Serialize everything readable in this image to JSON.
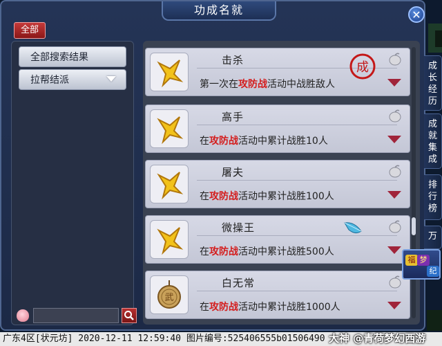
{
  "window": {
    "title": "功成名就",
    "close_label": "✕"
  },
  "filter": {
    "all_label": "全部"
  },
  "left_menu": {
    "items": [
      {
        "label": "全部搜索结果"
      },
      {
        "label": "拉帮结派"
      }
    ]
  },
  "search": {
    "placeholder": ""
  },
  "achievements": [
    {
      "title": "击杀",
      "desc_prefix": "第一次在",
      "highlight": "攻防战",
      "desc_suffix": "活动中战胜敌人",
      "icon": "star-icon",
      "completed_stamp": "成"
    },
    {
      "title": "高手",
      "desc_prefix": "在",
      "highlight": "攻防战",
      "desc_suffix": "活动中累计战胜10人",
      "icon": "star-icon"
    },
    {
      "title": "屠夫",
      "desc_prefix": "在",
      "highlight": "攻防战",
      "desc_suffix": "活动中累计战胜100人",
      "icon": "star-icon"
    },
    {
      "title": "微操王",
      "desc_prefix": "在",
      "highlight": "攻防战",
      "desc_suffix": "活动中累计战胜500人",
      "icon": "star-icon"
    },
    {
      "title": "白无常",
      "desc_prefix": "在",
      "highlight": "攻防战",
      "desc_suffix": "活动中累计战胜1000人",
      "icon": "medal-icon"
    }
  ],
  "side_tabs": [
    {
      "label": "成长经历"
    },
    {
      "label": "成就集成"
    },
    {
      "label": "排行榜"
    },
    {
      "label": "万"
    }
  ],
  "corner_badge": {
    "chars": [
      "福",
      "梦",
      "纪"
    ]
  },
  "status_bar": {
    "text": "广东4区[状元坊] 2020-12-11 12:59:40 图片编号:525406555b01506490"
  },
  "watermark": {
    "text": "大神 @青荷梦幻西游"
  },
  "colors": {
    "highlight_red": "#d41d1d",
    "accent_red": "#a0243a",
    "window_blue": "#243456"
  }
}
